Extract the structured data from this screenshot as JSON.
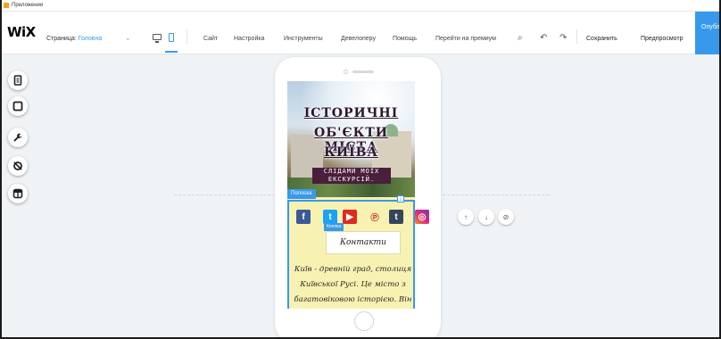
{
  "apps_bar": {
    "label": "Приложения"
  },
  "toolbar": {
    "logo": "WiX",
    "page_label": "Страница:",
    "page_value": "Головна",
    "menu": [
      "Сайт",
      "Настройка",
      "Инструменты",
      "Девелоперу",
      "Помощь",
      "Перейти на премиум"
    ],
    "save": "Сохранить",
    "preview": "Предпросмотр",
    "publish": "Опубликовать"
  },
  "left_tools": [
    "pages-icon",
    "background-icon",
    "wrench-icon",
    "hide-icon",
    "layers-icon"
  ],
  "site": {
    "hero_title_lines": [
      "ІСТОРИЧНІ",
      "ОБ'ЄКТИ МІСТА",
      "КИЇВА"
    ],
    "hero_subtitle_lines": [
      "СЛІДАМИ МОЇХ",
      "ЕКСКУРСІЙ."
    ],
    "strip_tag": "Полоска",
    "button_tag": "Кнопка",
    "contact_button": "Контакти",
    "body_text": "Київ - древній град, столиця Київської Русі. Це місто з багатовіковою історією. Він"
  },
  "colors": {
    "accent": "#3899ec",
    "site_bg": "#f8f2b2"
  }
}
